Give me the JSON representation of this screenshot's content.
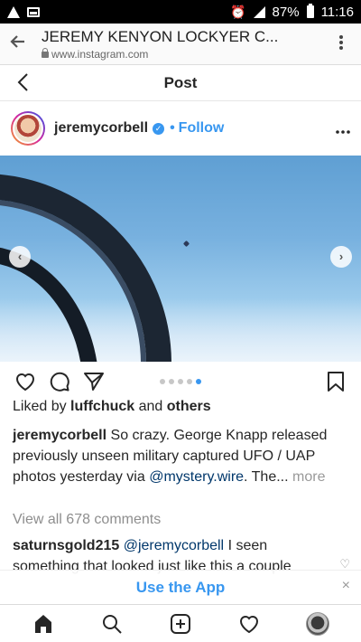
{
  "status_bar": {
    "battery": "87%",
    "time": "11:16"
  },
  "browser": {
    "page_title": "JEREMY KENYON LOCKYER C...",
    "url": "www.instagram.com"
  },
  "header": {
    "title": "Post"
  },
  "post": {
    "username": "jeremycorbell",
    "separator": "•",
    "follow_label": "Follow",
    "carousel": {
      "count": 5,
      "active_index": 4
    },
    "liked_by_prefix": "Liked by",
    "liked_by_user": "luffchuck",
    "liked_by_and": "and",
    "liked_by_others": "others",
    "caption_user": "jeremycorbell",
    "caption_text": "So crazy. George Knapp released previously unseen military captured UFO / UAP photos yesterday via",
    "caption_mention": "@mystery.wire",
    "caption_ellipsis": ". The...",
    "caption_more": "more",
    "view_all_comments": "View all 678 comments",
    "comment_user": "saturnsgold215",
    "comment_mention": "@jeremycorbell",
    "comment_text": "I seen something that looked just like this a couple"
  },
  "banner": {
    "use_app": "Use the App",
    "close": "×"
  },
  "colors": {
    "accent": "#3897f0",
    "status_bar": "#000000"
  },
  "icons": {
    "like": "heart-icon",
    "comment": "comment-icon",
    "share": "send-icon",
    "save": "bookmark-icon",
    "home": "home-icon",
    "search": "search-icon",
    "new_post": "plus-square-icon",
    "activity": "heart-icon",
    "profile": "avatar"
  }
}
